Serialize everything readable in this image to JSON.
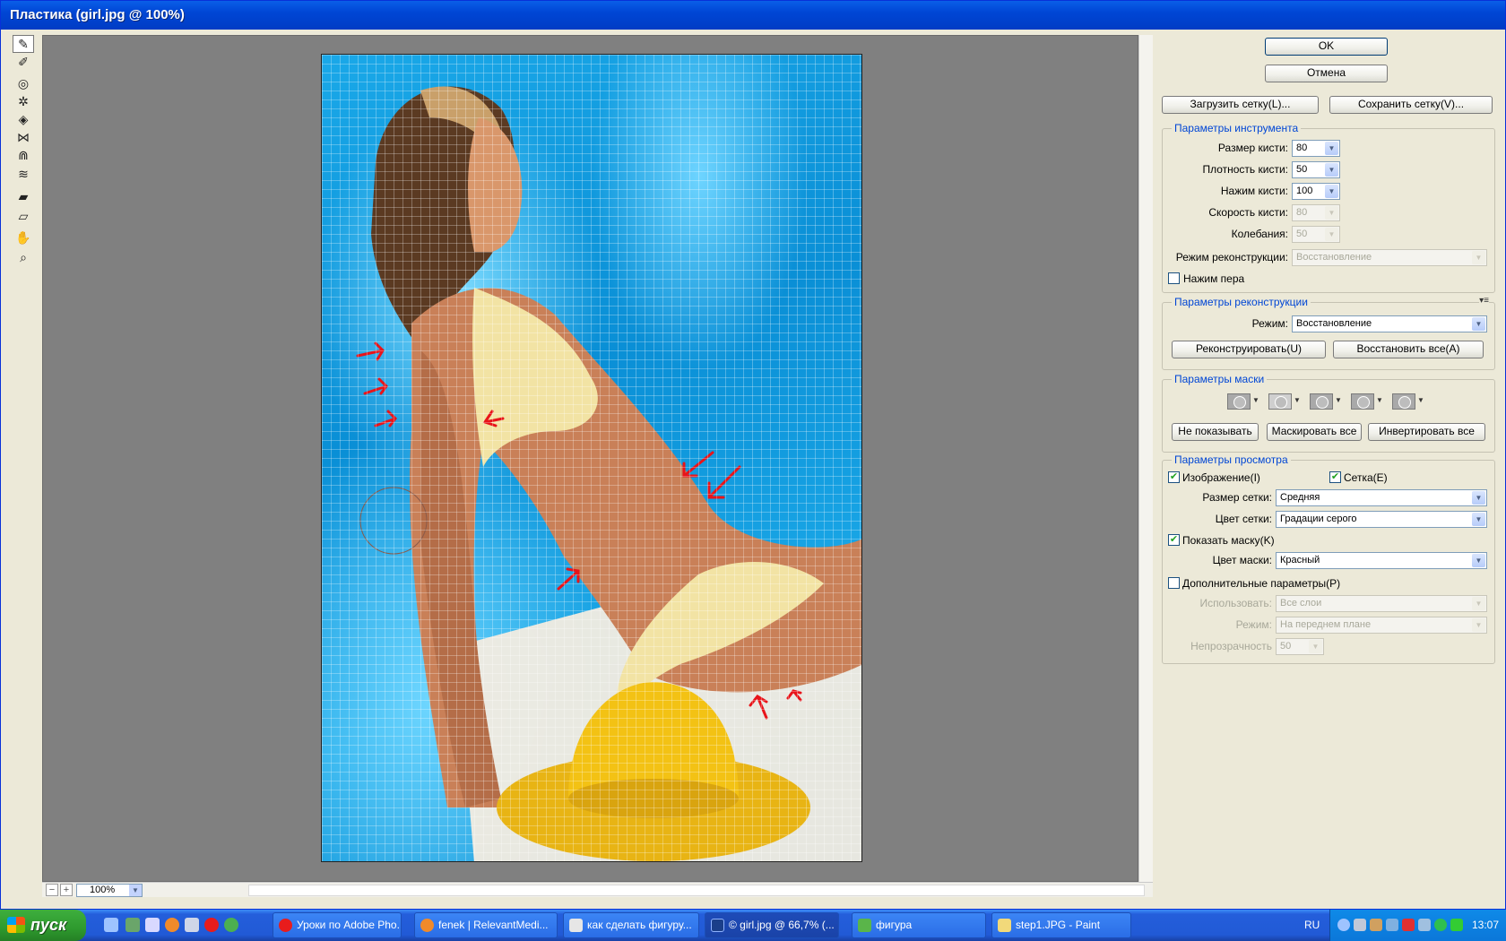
{
  "window": {
    "title": "Пластика (girl.jpg @ 100%)"
  },
  "zoom": {
    "value": "100%"
  },
  "buttons": {
    "ok": "OK",
    "cancel": "Отмена",
    "load_mesh": "Загрузить сетку(L)...",
    "save_mesh": "Сохранить сетку(V)..."
  },
  "tool_options": {
    "title": "Параметры инструмента",
    "brush_size_label": "Размер кисти:",
    "brush_size": "80",
    "brush_density_label": "Плотность кисти:",
    "brush_density": "50",
    "brush_pressure_label": "Нажим кисти:",
    "brush_pressure": "100",
    "brush_rate_label": "Скорость кисти:",
    "brush_rate": "80",
    "turbulence_label": "Колебания:",
    "turbulence": "50",
    "recon_mode_label": "Режим реконструкции:",
    "recon_mode": "Восстановление",
    "stylus_pressure_label": "Нажим пера"
  },
  "recon_options": {
    "title": "Параметры реконструкции",
    "mode_label": "Режим:",
    "mode": "Восстановление",
    "reconstruct": "Реконструировать(U)",
    "restore_all": "Восстановить все(A)"
  },
  "mask_options": {
    "title": "Параметры маски",
    "none": "Не показывать",
    "mask_all": "Маскировать все",
    "invert_all": "Инвертировать все"
  },
  "view_options": {
    "title": "Параметры просмотра",
    "image_label": "Изображение(I)",
    "image_checked": true,
    "mesh_label": "Сетка(E)",
    "mesh_checked": true,
    "mesh_size_label": "Размер сетки:",
    "mesh_size": "Средняя",
    "mesh_color_label": "Цвет сетки:",
    "mesh_color": "Градации серого",
    "show_mask_label": "Показать маску(K)",
    "show_mask_checked": true,
    "mask_color_label": "Цвет маски:",
    "mask_color": "Красный",
    "backdrop_label": "Дополнительные параметры(P)",
    "use_label": "Использовать:",
    "use": "Все слои",
    "mode_label": "Режим:",
    "mode": "На переднем плане",
    "opacity_label": "Непрозрачность",
    "opacity": "50"
  },
  "taskbar": {
    "start": "пуск",
    "tasks": [
      "Уроки по Adobe Pho...",
      "fenek | RelevantMedi...",
      "как сделать фигуру...",
      "© girl.jpg @ 66,7% (...",
      "фигура",
      "step1.JPG - Paint"
    ],
    "lang": "RU",
    "clock": "13:07"
  },
  "colors": {
    "title_blue": "#0046d5",
    "accent_arrow": "#e8141a",
    "taskbar": "#245edb"
  }
}
